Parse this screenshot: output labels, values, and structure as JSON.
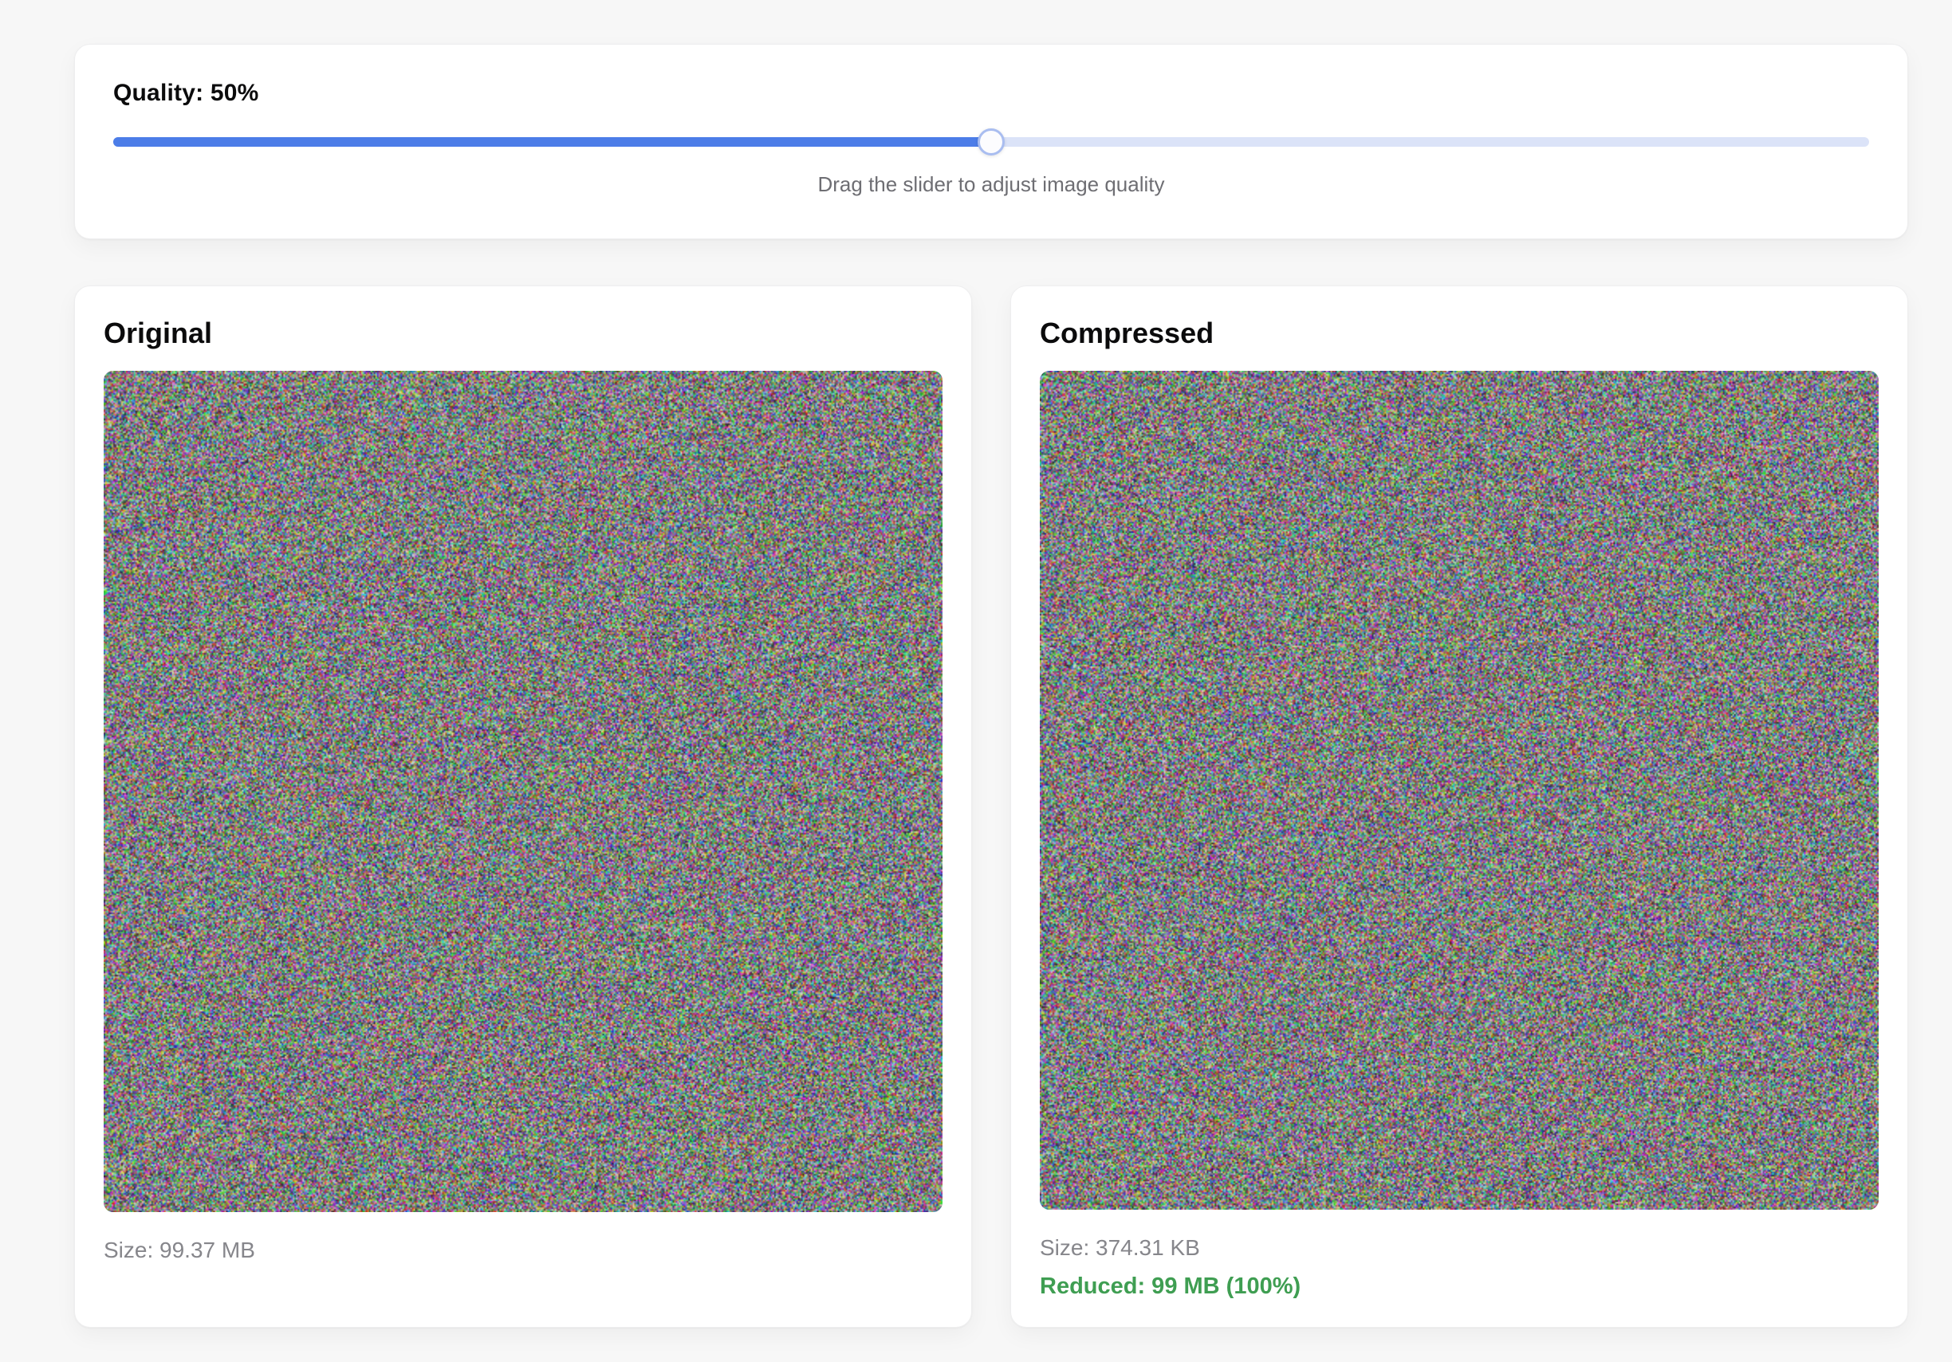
{
  "quality_panel": {
    "label": "Quality: 50%",
    "value_percent": 50,
    "hint": "Drag the slider to adjust image quality"
  },
  "comparison": {
    "original": {
      "title": "Original",
      "size_label": "Size: 99.37 MB"
    },
    "compressed": {
      "title": "Compressed",
      "size_label": "Size: 374.31 KB",
      "reduction_label": "Reduced: 99 MB (100%)"
    }
  },
  "colors": {
    "accent_blue": "#4c7de8",
    "track_inactive_blue": "#dbe3f8",
    "slider_thumb_border": "#a9bdf0",
    "success_green": "#3f9e52",
    "muted_text": "#6e6e73",
    "size_text": "#86868b",
    "page_background": "#f7f7f7",
    "card_background": "#ffffff"
  }
}
